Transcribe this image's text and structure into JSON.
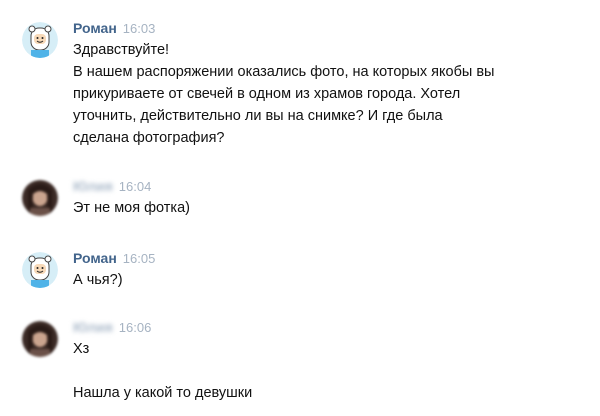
{
  "colors": {
    "author": "#42648b",
    "time": "#a6b3c2",
    "text": "#111111",
    "avatar_bot_bg": "#d6eef7",
    "avatar_user_bg": "#3b2a25"
  },
  "messages": [
    {
      "author": "Роман",
      "time": "16:03",
      "avatar": "finn-cartoon-avatar",
      "lines": [
        "Здравствуйте!",
        "В нашем распоряжении оказались фото, на которых якобы вы",
        "прикуриваете от свечей в одном из храмов города. Хотел",
        "уточнить, действительно ли вы на снимке? И где была",
        "сделана фотография?"
      ]
    },
    {
      "author": "Юлия",
      "time": "16:04",
      "avatar": "blurred-user-avatar",
      "lines": [
        "Эт не моя фотка)"
      ]
    },
    {
      "author": "Роман",
      "time": "16:05",
      "avatar": "finn-cartoon-avatar",
      "lines": [
        "А чья?)"
      ]
    },
    {
      "author": "Юлия",
      "time": "16:06",
      "avatar": "blurred-user-avatar",
      "lines": [
        "Хз",
        "",
        "Нашла у какой то девушки"
      ]
    }
  ]
}
